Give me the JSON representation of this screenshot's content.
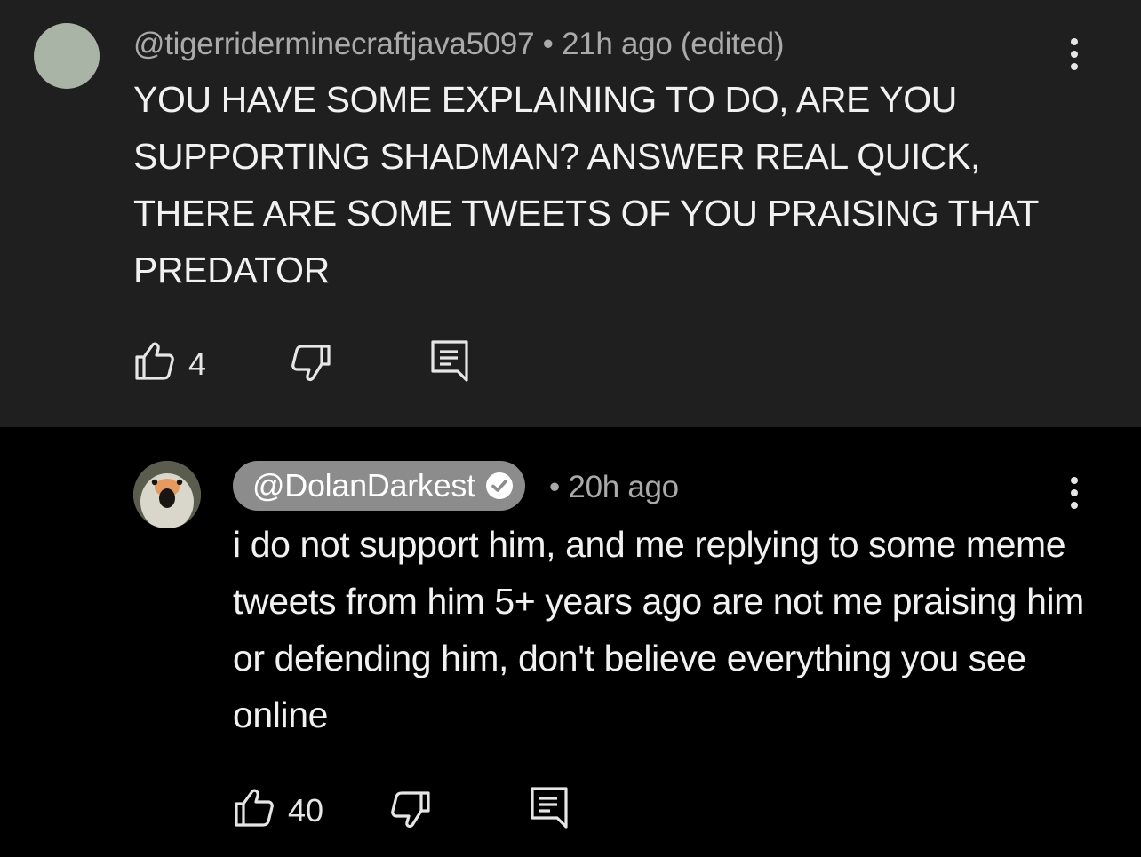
{
  "top_comment": {
    "handle": "@tigerriderminecraftjava5097",
    "separator": "•",
    "time": "21h ago (edited)",
    "text": "YOU HAVE SOME EXPLAINING TO DO, ARE YOU SUPPORTING SHADMAN? ANSWER REAL QUICK, THERE ARE SOME TWEETS OF YOU PRAISING THAT PREDATOR",
    "likes": "4",
    "icons": {
      "menu": "more-vert-icon",
      "like": "thumbs-up-icon",
      "dislike": "thumbs-down-icon",
      "reply": "reply-comment-icon"
    }
  },
  "reply_comment": {
    "handle": "@DolanDarkest",
    "separator": "•",
    "time": "20h ago",
    "verified": true,
    "text": "i do not support him, and me replying to some meme tweets from him 5+ years ago are not me praising him or defending him, don't believe everything you see online",
    "likes": "40",
    "icons": {
      "menu": "more-vert-icon",
      "like": "thumbs-up-icon",
      "dislike": "thumbs-down-icon",
      "reply": "reply-comment-icon",
      "verified": "verified-check-icon"
    }
  },
  "colors": {
    "top_background": "#1f1f1f",
    "reply_background": "#000000",
    "text_primary": "#f1f1f1",
    "text_secondary": "#aaaaaa",
    "handle_pill": "#8c8c8c"
  }
}
